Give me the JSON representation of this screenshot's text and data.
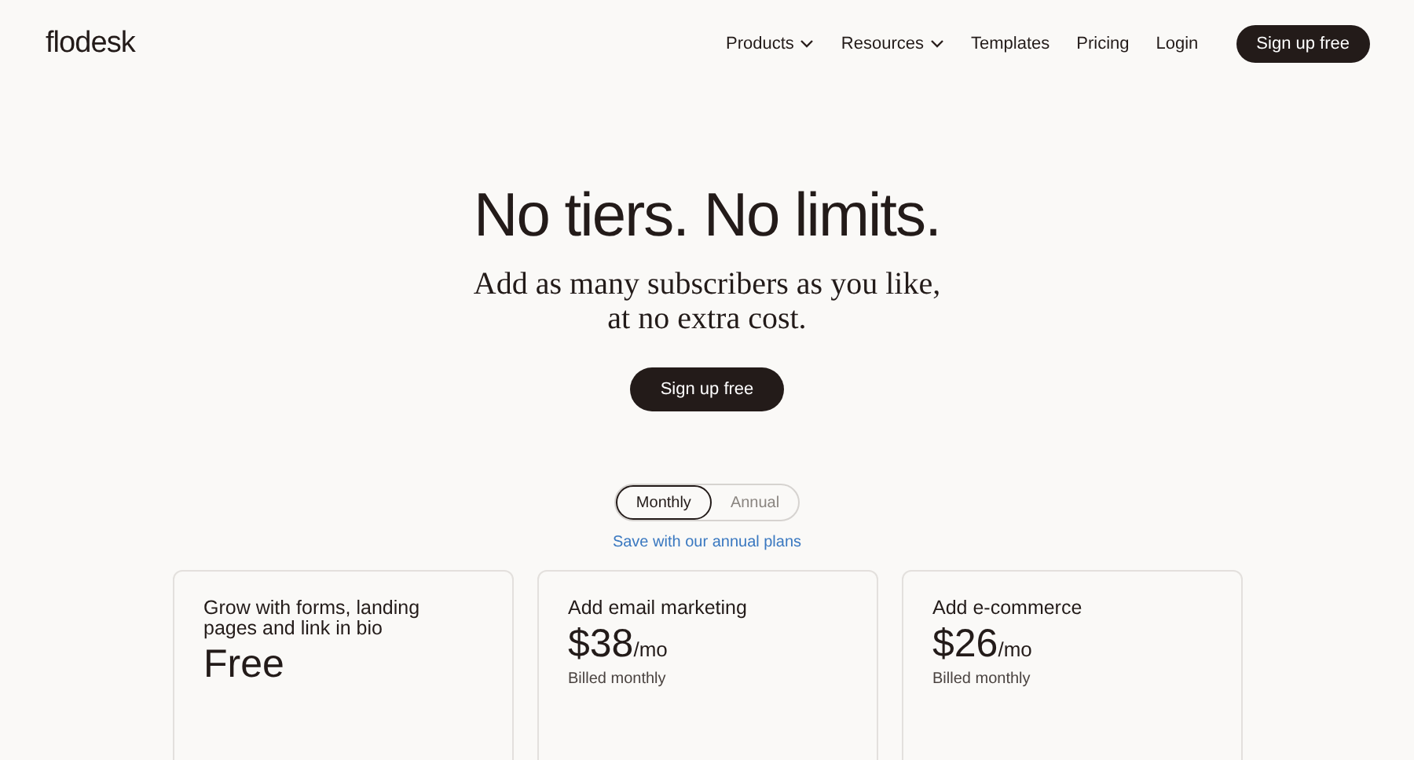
{
  "header": {
    "logo": "flodesk",
    "nav": [
      {
        "label": "Products",
        "dropdown": true
      },
      {
        "label": "Resources",
        "dropdown": true
      },
      {
        "label": "Templates",
        "dropdown": false
      },
      {
        "label": "Pricing",
        "dropdown": false
      },
      {
        "label": "Login",
        "dropdown": false
      }
    ],
    "cta": "Sign up free"
  },
  "hero": {
    "title": "No tiers. No limits.",
    "subtitle_lines": [
      "Add as many subscribers as you like,",
      "at no extra cost."
    ],
    "cta": "Sign up free"
  },
  "billing_toggle": [
    {
      "label": "Monthly",
      "selected": true
    },
    {
      "label": "Annual",
      "selected": false
    }
  ],
  "save_link": "Save with our annual plans",
  "plans": [
    {
      "title": "Grow with forms, landing pages and link in bio",
      "price": "Free"
    },
    {
      "title": "Add email marketing",
      "price": "$38",
      "unit": "/mo",
      "note": "Billed monthly"
    },
    {
      "title": "Add e-commerce",
      "price": "$26",
      "unit": "/mo",
      "note": "Billed monthly"
    }
  ]
}
